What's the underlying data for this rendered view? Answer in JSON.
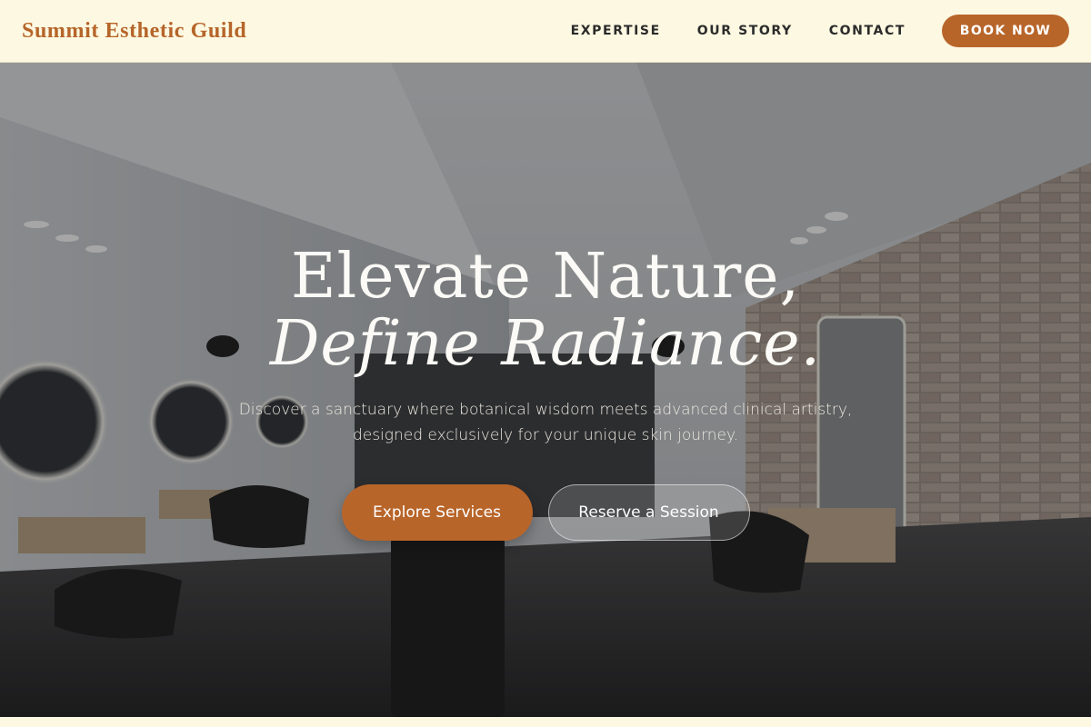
{
  "nav": {
    "brand": "Summit Esthetic Guild",
    "links": [
      "EXPERTISE",
      "OUR STORY",
      "CONTACT"
    ],
    "cta": "BOOK NOW"
  },
  "hero": {
    "headline_line1": "Elevate Nature,",
    "headline_line2": "Define Radiance.",
    "subtext_line1": "Discover a sanctuary where botanical wisdom meets advanced clinical artistry,",
    "subtext_line2": "designed exclusively for your unique skin journey.",
    "primary_cta": "Explore Services",
    "secondary_cta": "Reserve a Session"
  },
  "colors": {
    "accent": "#b8652a",
    "nav_background": "#fdf8e1",
    "brand_text": "#b6652a"
  }
}
